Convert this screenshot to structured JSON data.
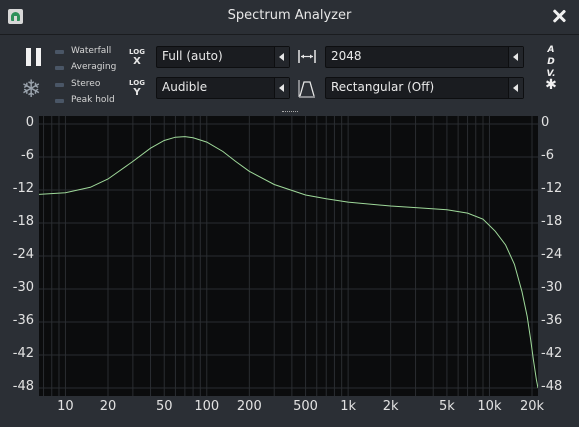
{
  "window": {
    "title": "Spectrum Analyzer"
  },
  "checks": [
    {
      "label": "Waterfall",
      "on": false
    },
    {
      "label": "Averaging",
      "on": false
    },
    {
      "label": "Stereo",
      "on": false
    },
    {
      "label": "Peak hold",
      "on": false
    }
  ],
  "logx": {
    "small": "LOG",
    "big": "X"
  },
  "logy": {
    "small": "LOG",
    "big": "Y"
  },
  "freq_range": "Full (auto)",
  "amp_range": "Audible",
  "block_size": "2048",
  "window_fn": "Rectangular (Off)",
  "adv": [
    "A",
    "D",
    "V."
  ],
  "colors": {
    "curve": "#9fd99a",
    "grid": "#2a2d31",
    "plot_bg": "#0b0c0d"
  },
  "icons": {
    "pause": "pause-icon",
    "freeze": "snowflake-icon",
    "settings": "gear-icon",
    "close": "close-icon"
  },
  "chart_data": {
    "type": "line",
    "x_scale": "log",
    "xlim": [
      6.5,
      22050
    ],
    "ylim": [
      -48,
      0
    ],
    "x_ticks": [
      10,
      20,
      50,
      100,
      200,
      500,
      1000,
      2000,
      5000,
      10000,
      20000
    ],
    "x_tick_labels": [
      "10",
      "20",
      "50",
      "100",
      "200",
      "500",
      "1k",
      "2k",
      "5k",
      "10k",
      "20k"
    ],
    "y_ticks": [
      0,
      -6,
      -12,
      -18,
      -24,
      -30,
      -36,
      -42,
      -48
    ],
    "y_tick_labels": [
      "0",
      "-6",
      "-12",
      "-18",
      "-24",
      "-30",
      "-36",
      "-42",
      "-48"
    ],
    "grid": true,
    "series": [
      {
        "x": [
          6.5,
          10,
          15,
          20,
          30,
          40,
          50,
          60,
          70,
          80,
          100,
          130,
          160,
          200,
          300,
          500,
          700,
          1000,
          2000,
          3000,
          5000,
          7000,
          9000,
          11000,
          13000,
          15000,
          17000,
          18500,
          19500,
          20500,
          21500,
          22050
        ],
        "y": [
          -12.8,
          -12.5,
          -11.5,
          -10.0,
          -6.8,
          -4.4,
          -3.0,
          -2.4,
          -2.3,
          -2.5,
          -3.3,
          -5.0,
          -6.8,
          -8.6,
          -11.0,
          -12.9,
          -13.6,
          -14.2,
          -14.9,
          -15.2,
          -15.6,
          -16.2,
          -17.3,
          -19.5,
          -22.0,
          -25.5,
          -30.5,
          -35.0,
          -39.0,
          -43.0,
          -46.5,
          -48.0
        ]
      }
    ]
  }
}
